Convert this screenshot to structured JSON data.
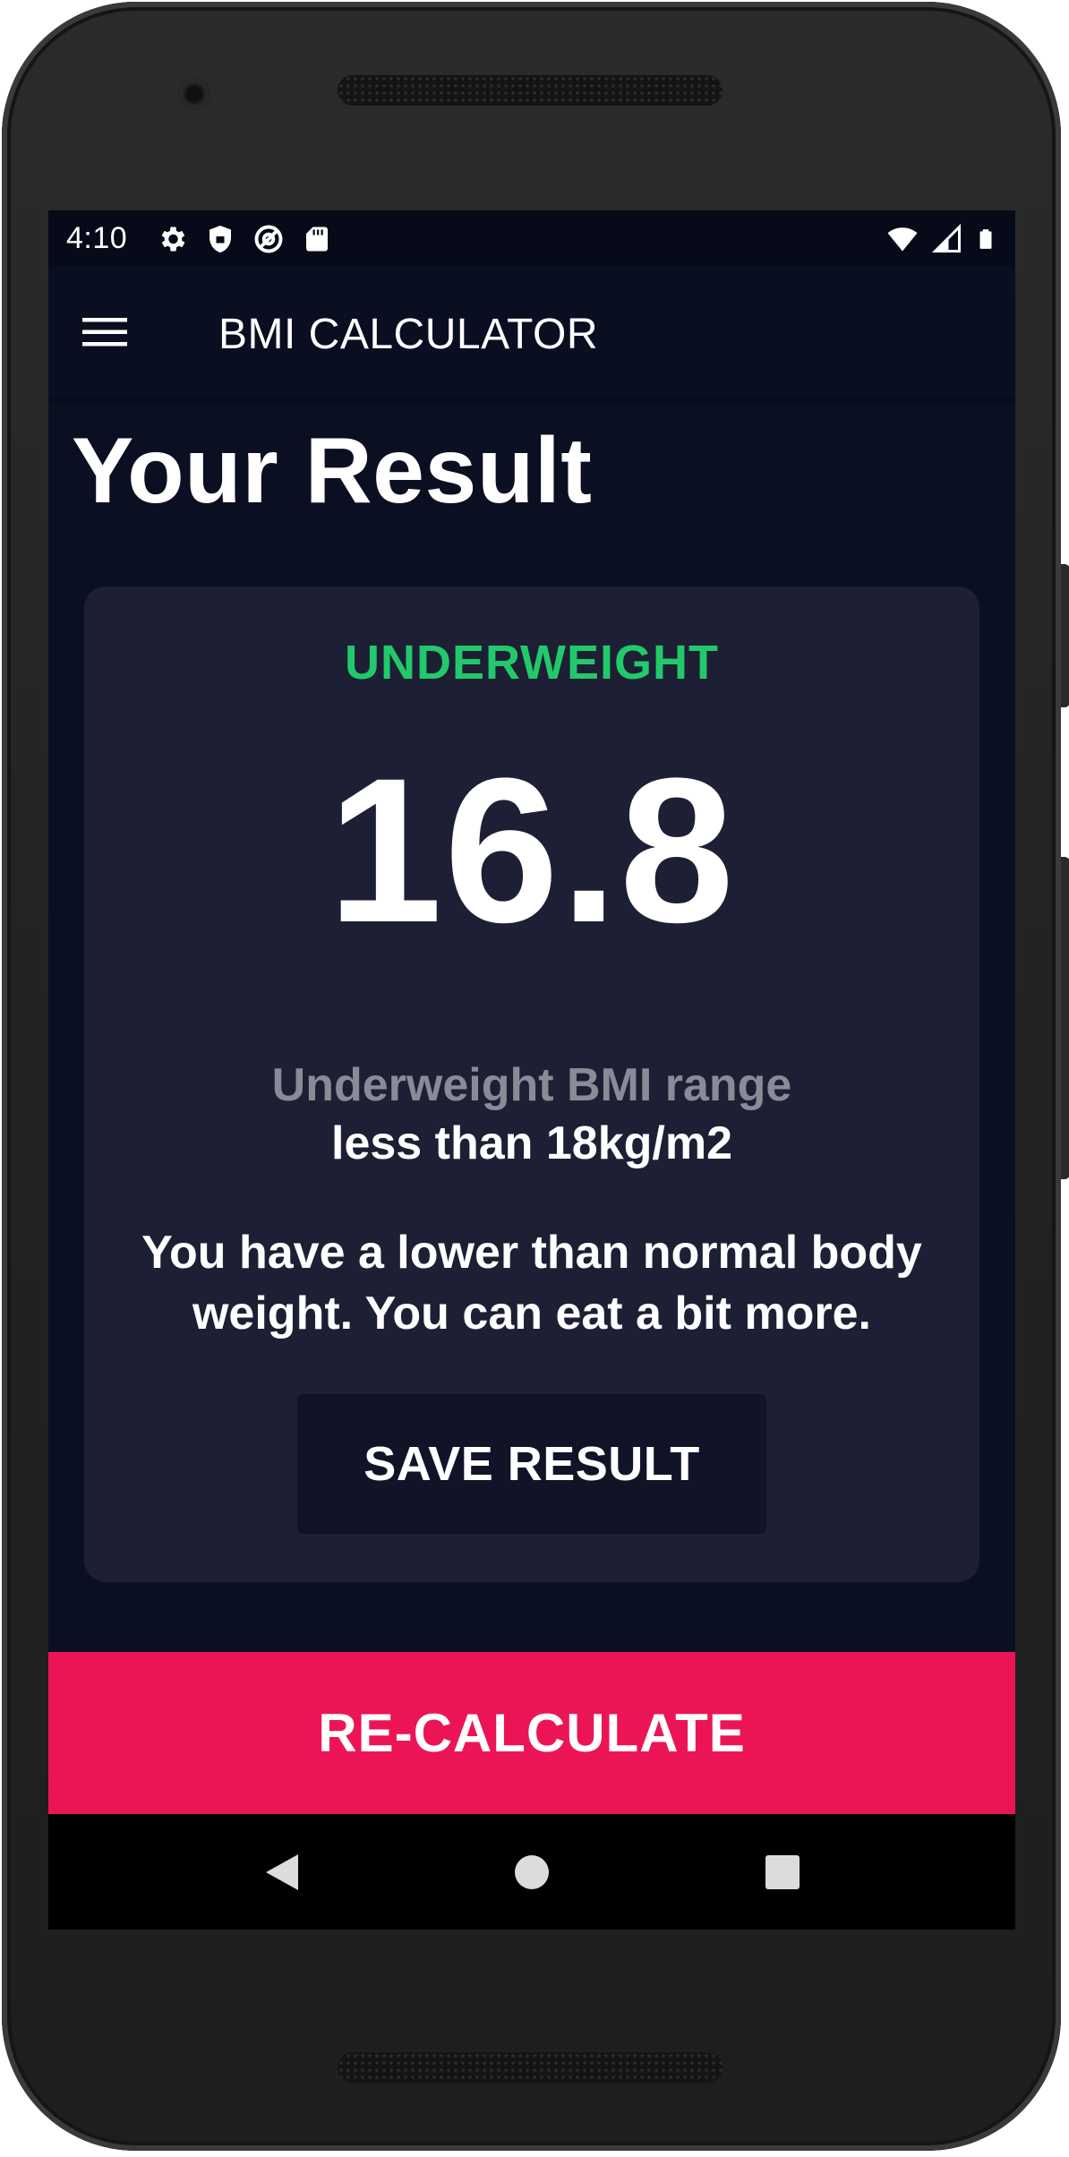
{
  "status_bar": {
    "time": "4:10",
    "left_icons": [
      "settings-icon",
      "shield-icon",
      "at-sign-icon",
      "sd-card-icon"
    ],
    "right_icons": [
      "wifi-icon",
      "signal-icon",
      "battery-icon"
    ]
  },
  "app_bar": {
    "menu_icon": "hamburger-menu-icon",
    "title": "BMI CALCULATOR"
  },
  "page": {
    "title": "Your Result"
  },
  "result": {
    "status": "UNDERWEIGHT",
    "bmi": "16.8",
    "range_label": "Underweight BMI range",
    "range_value": "less than 18kg/m2",
    "advice": "You have a lower than normal body weight. You can eat a bit more.",
    "save_label": "SAVE RESULT"
  },
  "footer": {
    "recalculate_label": "RE-CALCULATE"
  },
  "nav_bar": {
    "icons": [
      "back-icon",
      "home-icon",
      "recents-icon"
    ]
  },
  "colors": {
    "background": "#0b0f22",
    "card": "#1d1f34",
    "status_green": "#22c96b",
    "accent_pink": "#eb1555",
    "muted_text": "#8a8b97"
  }
}
